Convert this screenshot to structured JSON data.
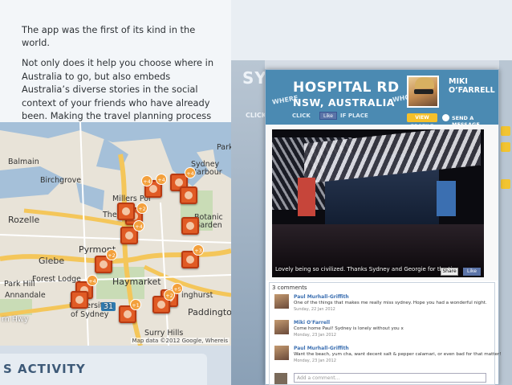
{
  "intro": {
    "line1": "The app was the first of its kind in the world.",
    "line2": "Not only does it help you choose where in Australia to go, but also embeds Australia’s diverse stories in the social context of your friends who have already been. Making the travel planning process truly personal."
  },
  "background_app": {
    "side_title": "SYD",
    "side_click": "CLICK"
  },
  "map": {
    "labels": {
      "birchgrove": "Birchgrove",
      "rozelle": "Rozelle",
      "millers_point": "Millers Poi",
      "pyrmont": "Pyrmont",
      "glebe": "Glebe",
      "haymarket": "Haymarket",
      "forest_lodge": "Forest Lodge",
      "annandale": "Annandale",
      "university": "University",
      "of_sydney": "of Sydney",
      "darlinghurst": "inghurst",
      "paddington": "Paddington",
      "surry_hills": "Surry Hills",
      "botanic": "Botanic",
      "garden": "Garden",
      "the_rocks": "The Roc",
      "sydney": "Sydney",
      "harbour": "Harbour",
      "park": "Park",
      "balmain": "Balmain",
      "park_hill": "Park Hill",
      "hwy": "rn Hwy",
      "route_31": "31"
    },
    "badges": [
      "+4",
      "+4",
      "+2",
      "+4",
      "+2",
      "+3",
      "+4",
      "+5",
      "+2",
      "+1",
      "+4",
      "+2",
      "+4",
      "+4"
    ],
    "credit": "Map data ©2012 Google, Whereis"
  },
  "activity": {
    "title": "S ACTIVITY"
  },
  "popup": {
    "where_label": "WHERE",
    "place_name": "HOSPITAL RD",
    "region": "NSW, AUSTRALIA",
    "who_label": "WHO",
    "person_name": "MIKI O’FARRELL",
    "view_profile": "VIEW PROFILE",
    "send_message": "SEND A MESSAGE",
    "click_if": "CLICK",
    "like": "Like",
    "fav_place": "IF PLACE",
    "photo_caption": "Lovely being so civilized. Thanks Sydney and Georgie for the tix",
    "share": "Share",
    "fb_like": "Like",
    "comments_count": "3 comments",
    "comments": [
      {
        "name": "Paul Murhall-Griffith",
        "text": "One of the things that makes me really miss sydney. Hope you had a wonderful night.",
        "date": "Sunday, 22 Jan 2012"
      },
      {
        "name": "Miki O'Farrell",
        "text": "Come home Paul! Sydney is lonely without you x",
        "date": "Monday, 23 Jan 2012"
      },
      {
        "name": "Paul Murhall-Griffith",
        "text": "Want the beach, yum cha, want decent salt & pepper calamari, or even bad for that matter!",
        "date": "Monday, 23 Jan 2012"
      }
    ],
    "add_comment_placeholder": "Add a comment..."
  }
}
